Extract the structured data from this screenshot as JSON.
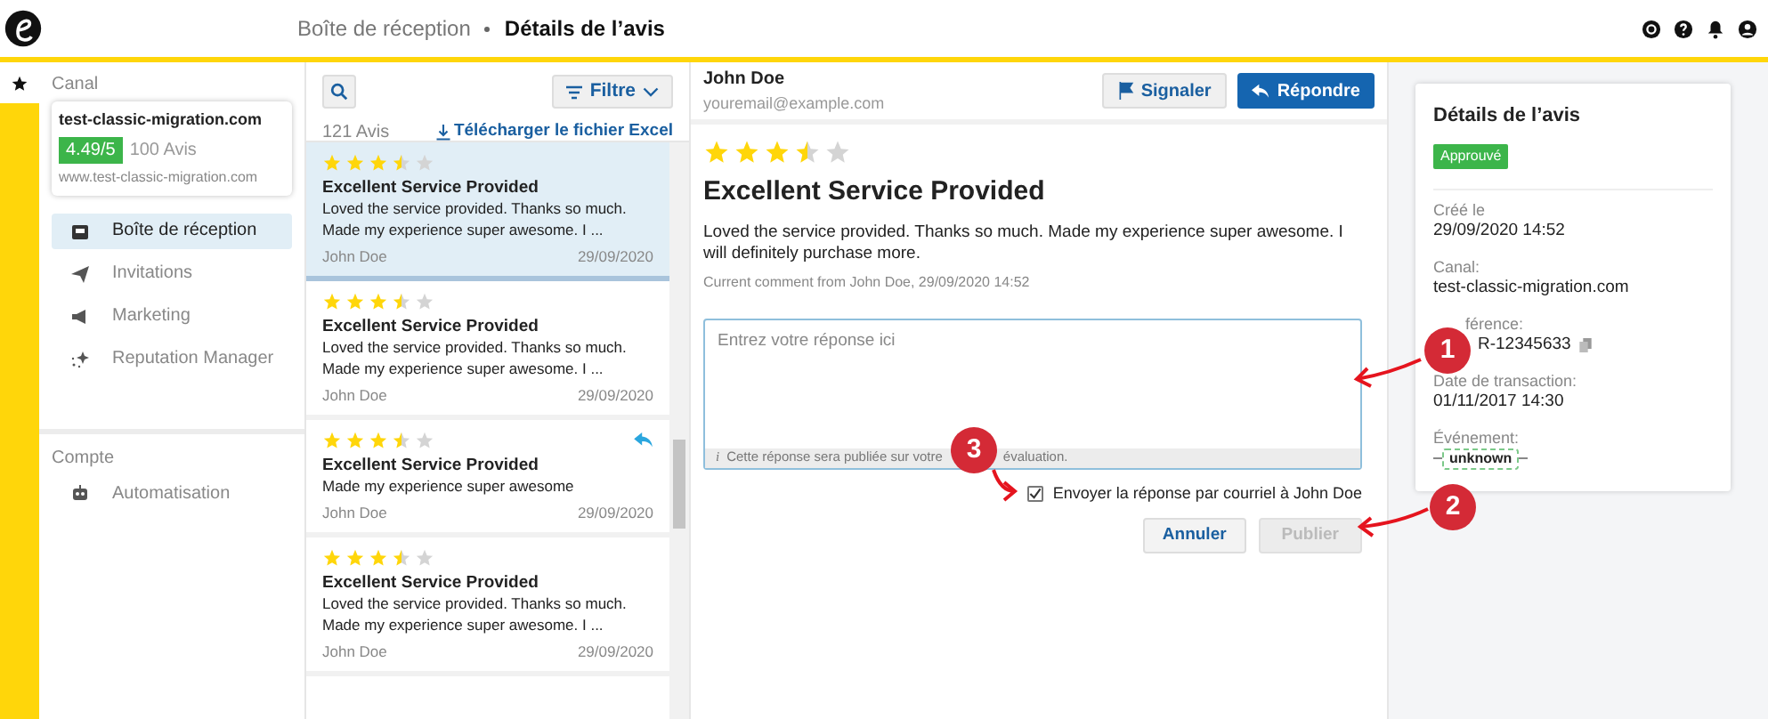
{
  "header": {
    "breadcrumb": [
      {
        "label": "Boîte de réception",
        "current": false
      },
      {
        "label": "Détails de l’avis",
        "current": true
      }
    ]
  },
  "sidebar": {
    "channel_label": "Canal",
    "channel": {
      "name": "test-classic-migration.com",
      "score": "4.49/5",
      "count": "100 Avis",
      "url": "www.test-classic-migration.com"
    },
    "items": [
      {
        "kind": "inbox",
        "label": "Boîte de réception",
        "selected": true
      },
      {
        "kind": "invitations",
        "label": "Invitations",
        "selected": false
      },
      {
        "kind": "marketing",
        "label": "Marketing",
        "selected": false
      },
      {
        "kind": "reputation",
        "label": "Reputation Manager",
        "selected": false
      }
    ],
    "account_label": "Compte",
    "account_items": [
      {
        "kind": "automation",
        "label": "Automatisation",
        "selected": false
      }
    ]
  },
  "list": {
    "count": "121 Avis",
    "filter": "Filtre",
    "download": "Télécharger le fichier Excel",
    "reviews": [
      {
        "stars": 3.5,
        "title": "Excellent Service Provided",
        "body": "Loved the service provided. Thanks so much. Made my experience super awesome. I ...",
        "author": "John Doe",
        "date": "29/09/2020",
        "selected": true,
        "replied": false
      },
      {
        "stars": 3.5,
        "title": "Excellent Service Provided",
        "body": "Loved the service provided. Thanks so much. Made my experience super awesome. I ...",
        "author": "John Doe",
        "date": "29/09/2020",
        "selected": false,
        "replied": false
      },
      {
        "stars": 3.5,
        "title": "Excellent Service Provided",
        "body": "Made my experience super awesome",
        "author": "John Doe",
        "date": "29/09/2020",
        "selected": false,
        "replied": true
      },
      {
        "stars": 3.5,
        "title": "Excellent Service Provided",
        "body": "Loved the service provided. Thanks so much. Made my experience super awesome. I ...",
        "author": "John Doe",
        "date": "29/09/2020",
        "selected": false,
        "replied": false
      }
    ]
  },
  "detail": {
    "author": "John Doe",
    "email": "youremail@example.com",
    "report": "Signaler",
    "reply": "Répondre",
    "stars": 3.5,
    "title": "Excellent Service Provided",
    "body": "Loved the service provided. Thanks so much. Made my experience super awesome. I will definitely purchase more.",
    "meta": "Current comment from John Doe, 29/09/2020 14:52",
    "reply_placeholder": "Entrez votre réponse ici",
    "info_icon": "i",
    "info": [
      "Cette réponse sera publiée sur votre",
      "évaluation."
    ],
    "send_email": {
      "label": "Envoyer la réponse par courriel à John Doe",
      "checked": true
    },
    "cancel": "Annuler",
    "publish": {
      "label": "Publier",
      "disabled": true
    }
  },
  "details_card": {
    "title": "Détails de l’avis",
    "status": "Approuvé",
    "fields": [
      {
        "kind": "text",
        "label": "Créé le",
        "value": "29/09/2020 14:52"
      },
      {
        "kind": "text",
        "label": "Canal:",
        "value": "test-classic-migration.com"
      },
      {
        "kind": "copy",
        "label": "férence:",
        "value": "R-12345633"
      },
      {
        "kind": "text",
        "label": "Date de transaction:",
        "value": "01/11/2017 14:30"
      },
      {
        "kind": "tag",
        "label": "Événement:",
        "value": "unknown"
      }
    ]
  },
  "annotations": [
    {
      "number": "1"
    },
    {
      "number": "2"
    },
    {
      "number": "3"
    }
  ]
}
